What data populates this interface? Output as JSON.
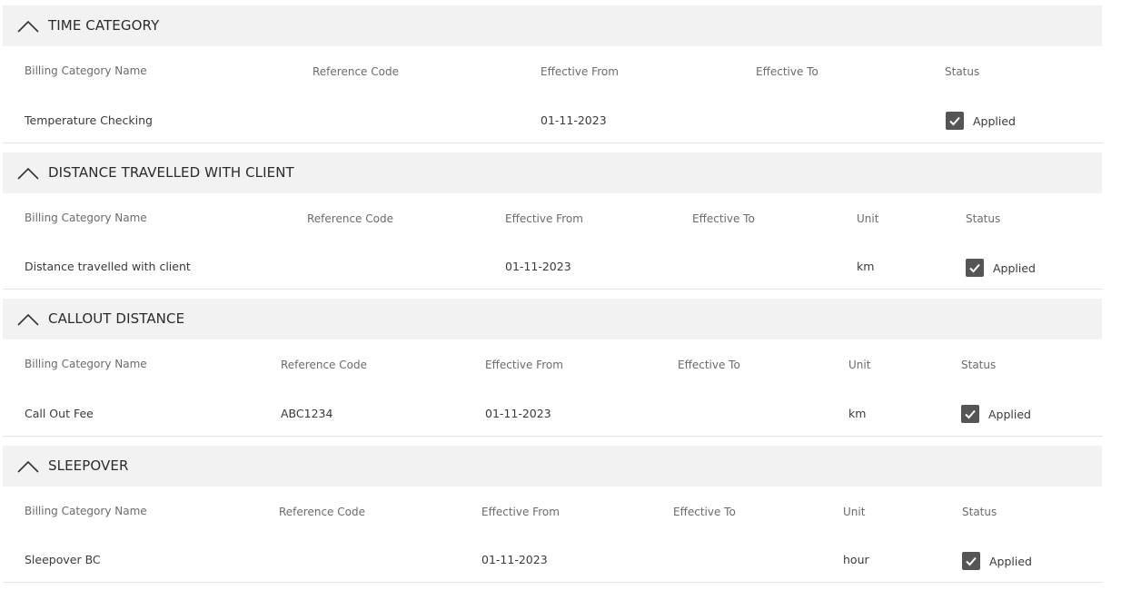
{
  "sections": [
    {
      "title": "TIME CATEGORY",
      "headers": [
        "Billing Category Name",
        "Reference Code",
        "Effective From",
        "Effective To",
        "Status"
      ],
      "row": {
        "name": "Temperature Checking",
        "reference_code": "",
        "effective_from": "01-11-2023",
        "effective_to": "",
        "status": "Applied",
        "checked": true
      }
    },
    {
      "title": "DISTANCE TRAVELLED WITH CLIENT",
      "headers": [
        "Billing Category Name",
        "Reference Code",
        "Effective From",
        "Effective To",
        "Unit",
        "Status"
      ],
      "row": {
        "name": "Distance travelled with client",
        "reference_code": "",
        "effective_from": "01-11-2023",
        "effective_to": "",
        "unit": "km",
        "status": "Applied",
        "checked": true
      }
    },
    {
      "title": "CALLOUT DISTANCE",
      "headers": [
        "Billing Category Name",
        "Reference Code",
        "Effective From",
        "Effective To",
        "Unit",
        "Status"
      ],
      "row": {
        "name": "Call Out Fee",
        "reference_code": "ABC1234",
        "effective_from": "01-11-2023",
        "effective_to": "",
        "unit": "km",
        "status": "Applied",
        "checked": true
      }
    },
    {
      "title": "SLEEPOVER",
      "headers": [
        "Billing Category Name",
        "Reference Code",
        "Effective From",
        "Effective To",
        "Unit",
        "Status"
      ],
      "row": {
        "name": "Sleepover BC",
        "reference_code": "",
        "effective_from": "01-11-2023",
        "effective_to": "",
        "unit": "hour",
        "status": "Applied",
        "checked": true
      }
    }
  ],
  "icons": {
    "collapse": "chevron-up-icon",
    "checkbox": "checkmark-icon"
  },
  "colors": {
    "header_bg": "#f2f2f3",
    "checkbox_bg": "#555555",
    "divider": "#e4e4e4"
  }
}
